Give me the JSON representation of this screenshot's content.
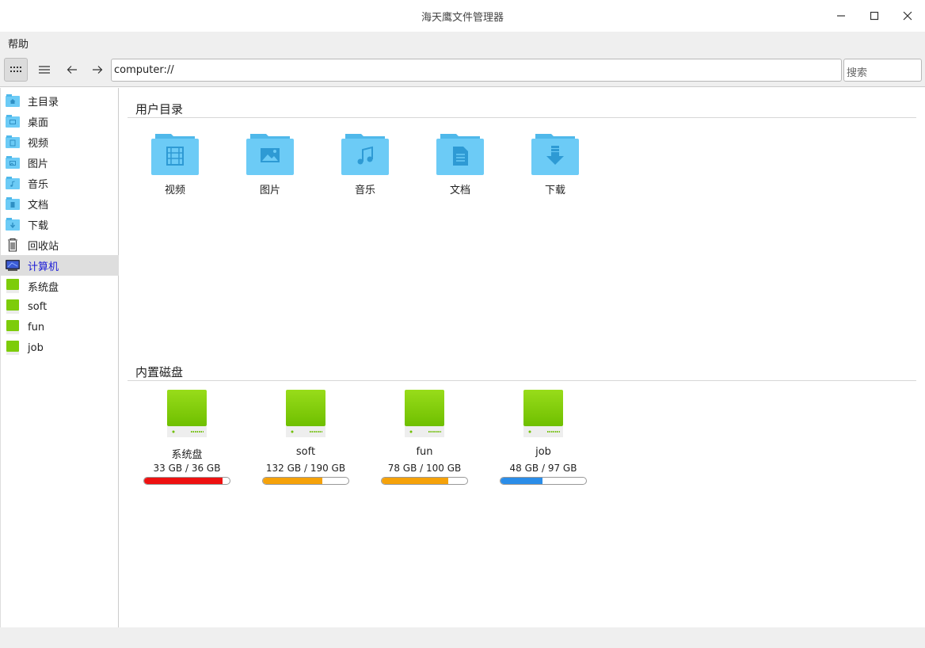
{
  "window": {
    "title": "海天鹰文件管理器"
  },
  "menu": {
    "help": "帮助"
  },
  "toolbar": {
    "address": "computer://",
    "search_placeholder": "搜索"
  },
  "sidebar": {
    "items": [
      {
        "label": "主目录",
        "icon": "home-folder-icon"
      },
      {
        "label": "桌面",
        "icon": "desktop-folder-icon"
      },
      {
        "label": "视频",
        "icon": "video-folder-icon"
      },
      {
        "label": "图片",
        "icon": "pictures-folder-icon"
      },
      {
        "label": "音乐",
        "icon": "music-folder-icon"
      },
      {
        "label": "文档",
        "icon": "documents-folder-icon"
      },
      {
        "label": "下载",
        "icon": "downloads-folder-icon"
      },
      {
        "label": "回收站",
        "icon": "trash-icon"
      },
      {
        "label": "计算机",
        "icon": "computer-icon",
        "selected": true
      },
      {
        "label": "系统盘",
        "icon": "drive-icon"
      },
      {
        "label": "soft",
        "icon": "drive-icon"
      },
      {
        "label": "fun",
        "icon": "drive-icon"
      },
      {
        "label": "job",
        "icon": "drive-icon"
      }
    ]
  },
  "main": {
    "user_dirs_title": "用户目录",
    "folders": [
      {
        "label": "视频",
        "icon": "video-folder-icon"
      },
      {
        "label": "图片",
        "icon": "pictures-folder-icon"
      },
      {
        "label": "音乐",
        "icon": "music-folder-icon"
      },
      {
        "label": "文档",
        "icon": "documents-folder-icon"
      },
      {
        "label": "下载",
        "icon": "downloads-folder-icon"
      }
    ],
    "drives_title": "内置磁盘",
    "drives": [
      {
        "label": "系统盘",
        "size": "33 GB / 36 GB",
        "used_fraction": 0.92,
        "color": "#ee1111"
      },
      {
        "label": "soft",
        "size": "132 GB / 190 GB",
        "used_fraction": 0.69,
        "color": "#f5a20a"
      },
      {
        "label": "fun",
        "size": "78 GB / 100 GB",
        "used_fraction": 0.78,
        "color": "#f5a20a"
      },
      {
        "label": "job",
        "size": "48 GB / 97 GB",
        "used_fraction": 0.49,
        "color": "#2b8de8"
      }
    ]
  },
  "colors": {
    "folder": "#6ccbf6",
    "folder_dark": "#4fb8ea",
    "drive": "#7dcc0a",
    "selected_text": "#1a1ad6"
  }
}
